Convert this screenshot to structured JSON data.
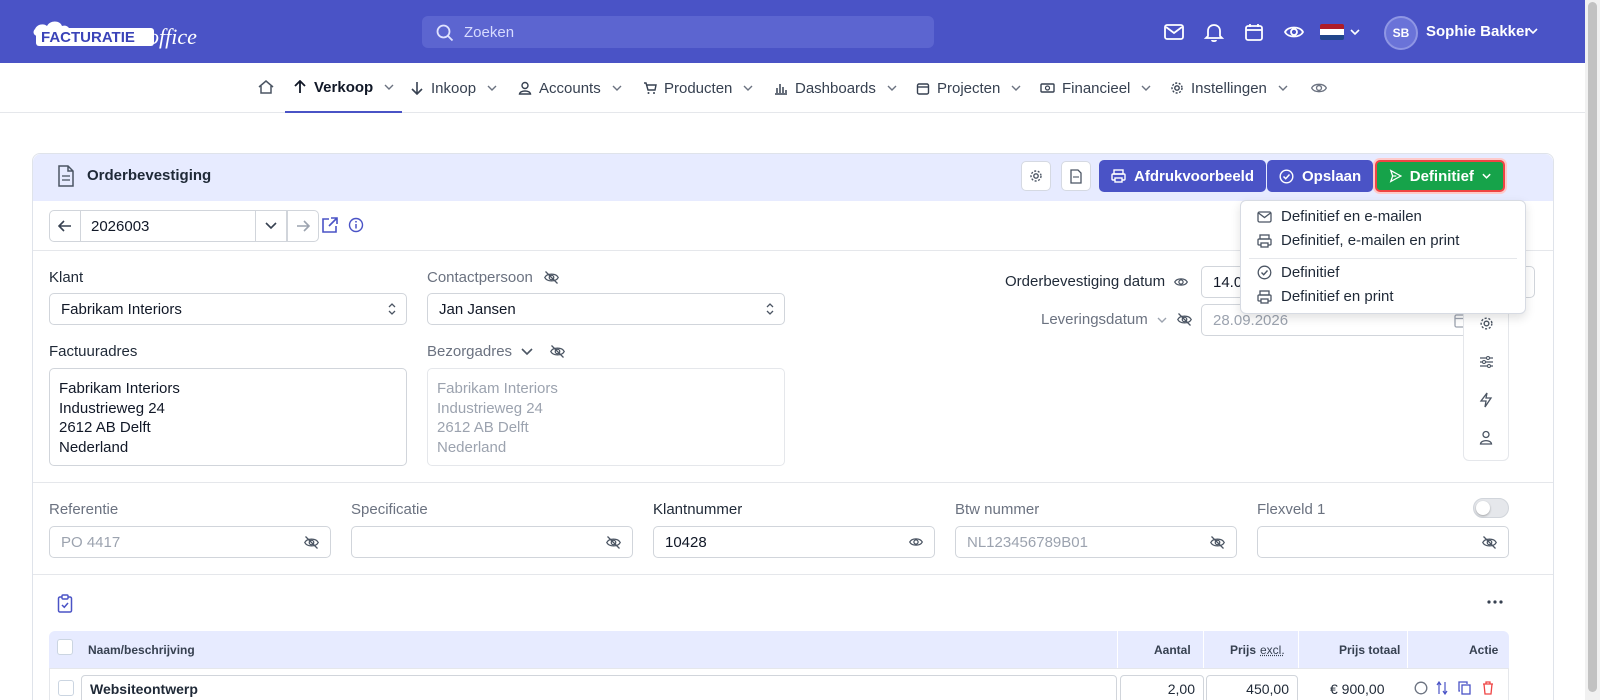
{
  "topbar": {
    "logo_text": "FACTURATIEoffice",
    "search_placeholder": "Zoeken",
    "user_initials": "SB",
    "user_name": "Sophie Bakker",
    "accent_color": "#4a53c6"
  },
  "nav": {
    "items": [
      {
        "label": "Verkoop",
        "icon": "arrow-up-icon",
        "active": true
      },
      {
        "label": "Inkoop",
        "icon": "arrow-down-icon"
      },
      {
        "label": "Accounts",
        "icon": "user-icon"
      },
      {
        "label": "Producten",
        "icon": "cart-icon"
      },
      {
        "label": "Dashboards",
        "icon": "bar-chart-icon"
      },
      {
        "label": "Projecten",
        "icon": "calendar-icon"
      },
      {
        "label": "Financieel",
        "icon": "cash-icon"
      },
      {
        "label": "Instellingen",
        "icon": "gear-icon"
      }
    ]
  },
  "card": {
    "title": "Orderbevestiging",
    "preview_label": "Afdrukvoorbeeld",
    "save_label": "Opslaan",
    "final_label": "Definitief",
    "record_number": "2026003"
  },
  "dropdown": {
    "items": [
      "Definitief en e-mailen",
      "Definitief, e-mailen en print",
      "Definitief",
      "Definitief en print"
    ]
  },
  "form": {
    "klant_label": "Klant",
    "klant_value": "Fabrikam Interiors",
    "contact_label": "Contactpersoon",
    "contact_value": "Jan Jansen",
    "factuur_label": "Factuuradres",
    "factuur_lines": [
      "Fabrikam Interiors",
      "Industrieweg 24",
      "2612 AB Delft",
      "Nederland"
    ],
    "bezorg_label": "Bezorgadres",
    "bezorg_lines": [
      "Fabrikam Interiors",
      "Industrieweg 24",
      "2612 AB Delft",
      "Nederland"
    ],
    "order_date_label": "Orderbevestiging datum",
    "order_date_value": "14.09",
    "delivery_label": "Leveringsdatum",
    "delivery_placeholder": "28.09.2026",
    "referentie_label": "Referentie",
    "referentie_placeholder": "PO 4417",
    "specificatie_label": "Specificatie",
    "klantnummer_label": "Klantnummer",
    "klantnummer_value": "10428",
    "btw_label": "Btw nummer",
    "btw_placeholder": "NL123456789B01",
    "flexveld_label": "Flexveld 1"
  },
  "table": {
    "headers": {
      "name": "Naam/beschrijving",
      "qty": "Aantal",
      "price": "Prijs",
      "price_sub": "excl.",
      "total": "Prijs totaal",
      "action": "Actie"
    },
    "rows": [
      {
        "name": "Websiteontwerp",
        "qty": "2,00",
        "price": "450,00",
        "total": "€ 900,00"
      }
    ]
  }
}
